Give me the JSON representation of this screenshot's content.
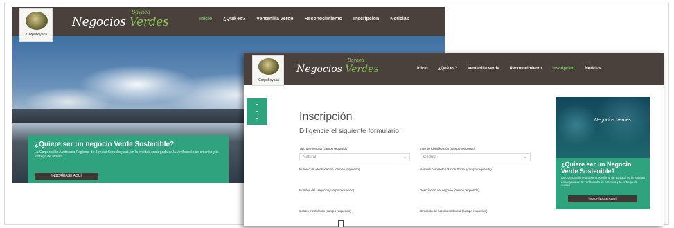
{
  "back_window": {
    "logo_caption": "Corpoboyacá",
    "brand": "Negocios",
    "brand_accent": "Verdes",
    "brand_sub": "Boyacá",
    "nav": [
      "Inicio",
      "¿Qué es?",
      "Ventanilla verde",
      "Reconocimiento",
      "Inscripción",
      "Noticias"
    ],
    "active_nav": 0,
    "banner_title": "¿Quiere ser un negocio Verde Sostenible?",
    "banner_text": "La Corporación Autónoma Regional de Boyacá Corpoboyacá, en la entidad encargada de la verificación de criterios y la entrega de avales.",
    "banner_button": "INSCRÍBASE AQUÍ"
  },
  "front_window": {
    "logo_caption": "Corpoboyacá",
    "brand": "Negocios",
    "brand_accent": "Verdes",
    "brand_sub": "Boyacá",
    "nav": [
      "Inicio",
      "¿Qué es?",
      "Ventanilla verde",
      "Reconocimiento",
      "Inscripción",
      "Noticias"
    ],
    "active_nav": 4,
    "title": "Inscripción",
    "subtitle": "Diligencie el siguiente formulario:",
    "fields": [
      {
        "label": "Tipo de Persona (campo requerido)",
        "value": "Natural",
        "has_select": true
      },
      {
        "label": "Tipo de identificación (campo requerido)",
        "value": "Cédula",
        "has_select": true
      },
      {
        "label": "Número de identificación (campo requerido)",
        "value": "",
        "has_select": false
      },
      {
        "label": "Nombre completo / Razón Social (campo requerido)",
        "value": "",
        "has_select": false
      },
      {
        "label": "Nombre del Negocio (campo requerido)",
        "value": "",
        "has_select": false
      },
      {
        "label": "Descripción del negocio (campo requerido)",
        "value": "",
        "has_select": false
      },
      {
        "label": "Correo electrónico (campo requerido)",
        "value": "",
        "has_select": false
      },
      {
        "label": "Dirección de correspondencia (campo requerido)",
        "value": "",
        "has_select": false
      }
    ],
    "ad_logo": "Negocios Verdes",
    "ad_title": "¿Quiere ser un Negocio Verde Sostenible?",
    "ad_text": "La Corporación Autónoma Regional de Boyacá es la entidad encargada de la verificación de criterios y la entrega de avales.",
    "ad_button": "INSCRÍBASE AQUÍ"
  },
  "colors": {
    "header": "#4a413c",
    "accent_green": "#2fa37e",
    "brand_green": "#86c14f"
  }
}
